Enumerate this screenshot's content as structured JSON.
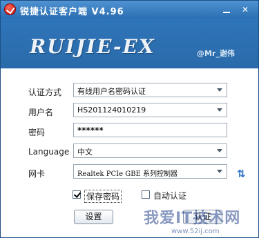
{
  "window": {
    "title": "锐捷认证客户端 V4.96"
  },
  "banner": {
    "logo_text": "RUIJIE-EX",
    "watermark": "@Mr_谢伟"
  },
  "form": {
    "auth_method": {
      "label": "认证方式",
      "value": "有线用户名密码认证"
    },
    "username": {
      "label": "用户名",
      "value": "HS201124010219"
    },
    "password": {
      "label": "密码",
      "value": "******"
    },
    "language": {
      "label": "Language",
      "value": "中文"
    },
    "nic": {
      "label": "网卡",
      "value": "Realtek PCIe GBE 系列控制器"
    }
  },
  "options": {
    "save_password": {
      "label": "保存密码",
      "checked": true
    },
    "auto_auth": {
      "label": "自动认证",
      "checked": false
    }
  },
  "buttons": {
    "settings": "设置",
    "authenticate": "认证"
  },
  "site_watermark": {
    "text": "我爱IT技术网",
    "url": "www.52ij.com"
  },
  "colors": {
    "title_bar": "#2b6fb2",
    "banner": "#2f75ba",
    "panel": "#ffffff"
  },
  "icons": [
    "app-logo-icon",
    "minimize-icon",
    "close-icon",
    "dropdown-arrow-icon",
    "refresh-icon"
  ]
}
